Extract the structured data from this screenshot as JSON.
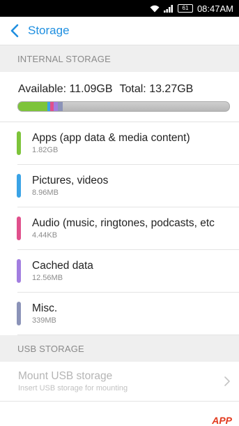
{
  "status_bar": {
    "time": "08:47AM",
    "battery": "61",
    "icons": [
      "wifi-icon",
      "signal-icon",
      "battery-icon"
    ]
  },
  "header": {
    "title": "Storage",
    "back_icon": "chevron-left-icon"
  },
  "internal": {
    "section_label": "INTERNAL STORAGE",
    "available_text": "Available: 11.09GB",
    "total_text": "Total: 13.27GB",
    "usage_bar": [
      {
        "category": "Apps (app data & media content)",
        "fraction": 0.137,
        "color": "#7dc43a"
      },
      {
        "category": "Pictures, videos",
        "fraction": 0.015,
        "color": "#3aa3e6"
      },
      {
        "category": "Audio (music, ringtones, podcasts, etc",
        "fraction": 0.015,
        "color": "#e0508c"
      },
      {
        "category": "Cached data",
        "fraction": 0.02,
        "color": "#a27ee0"
      },
      {
        "category": "Misc.",
        "fraction": 0.026,
        "color": "#8b93b8"
      }
    ],
    "items": [
      {
        "label": "Apps (app data & media content)",
        "size": "1.82GB",
        "color": "#7dc43a"
      },
      {
        "label": "Pictures, videos",
        "size": "8.96MB",
        "color": "#3aa3e6"
      },
      {
        "label": "Audio (music, ringtones, podcasts, etc",
        "size": "4.44KB",
        "color": "#e0508c"
      },
      {
        "label": "Cached data",
        "size": "12.56MB",
        "color": "#a27ee0"
      },
      {
        "label": "Misc.",
        "size": "339MB",
        "color": "#8b93b8"
      }
    ]
  },
  "usb": {
    "section_label": "USB STORAGE",
    "mount_title": "Mount USB storage",
    "mount_subtitle": "Insert USB storage for mounting",
    "chevron_icon": "chevron-right-icon"
  },
  "watermark": "APP"
}
